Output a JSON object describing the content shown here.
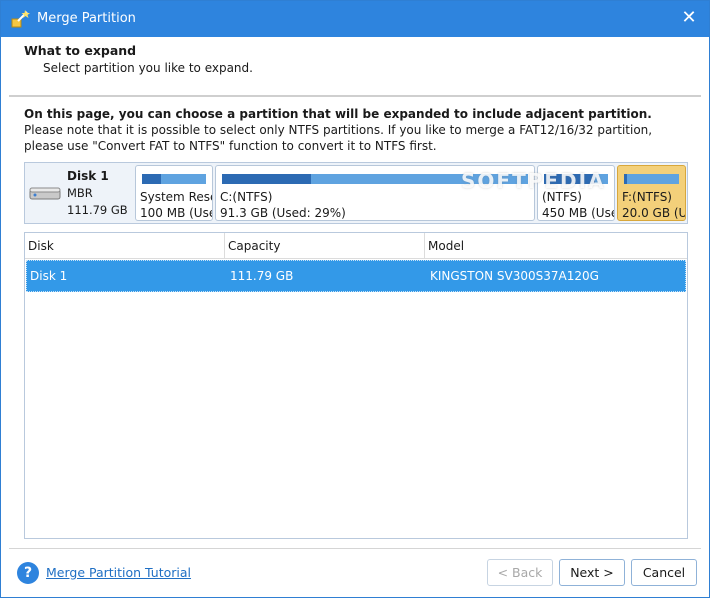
{
  "window": {
    "title": "Merge Partition",
    "close_glyph": "✕"
  },
  "header": {
    "title": "What to expand",
    "subtitle": "Select partition you like to expand."
  },
  "description": {
    "bold": "On this page, you can choose a partition that will be expanded to include adjacent partition.",
    "rest": " Please note that it is possible to select only NTFS partitions. If you like to merge a FAT12/16/32 partition, please use \"Convert FAT to NTFS\" function to convert it to NTFS first."
  },
  "disk_map": {
    "disk": {
      "name": "Disk 1",
      "type": "MBR",
      "size": "111.79 GB"
    },
    "partitions": [
      {
        "label": "System Rese",
        "info": "100 MB (Use",
        "used_fraction": 0.3
      },
      {
        "label": "C:(NTFS)",
        "info": "91.3 GB (Used: 29%)",
        "used_fraction": 0.29
      },
      {
        "label": "(NTFS)",
        "info": "450 MB (Use",
        "used_fraction": 0.8
      },
      {
        "label": "F:(NTFS)",
        "info": "20.0 GB (U",
        "used_fraction": 0.05,
        "selected": true
      }
    ],
    "watermark": "SOFTPEDIA"
  },
  "table": {
    "columns": [
      "Disk",
      "Capacity",
      "Model"
    ],
    "rows": [
      {
        "disk": "Disk 1",
        "capacity": "111.79 GB",
        "model": "KINGSTON SV300S37A120G",
        "selected": true
      }
    ]
  },
  "footer": {
    "help_label": "Merge Partition Tutorial",
    "help_glyph": "?",
    "back_label": "< Back",
    "next_label": "Next >",
    "cancel_label": "Cancel"
  },
  "colors": {
    "titlebar": "#2e84de",
    "selected_row": "#3399e8",
    "selected_partition": "#f3d07a",
    "usage_bar": "#5fa3e0",
    "usage_used": "#2c6ab3"
  }
}
